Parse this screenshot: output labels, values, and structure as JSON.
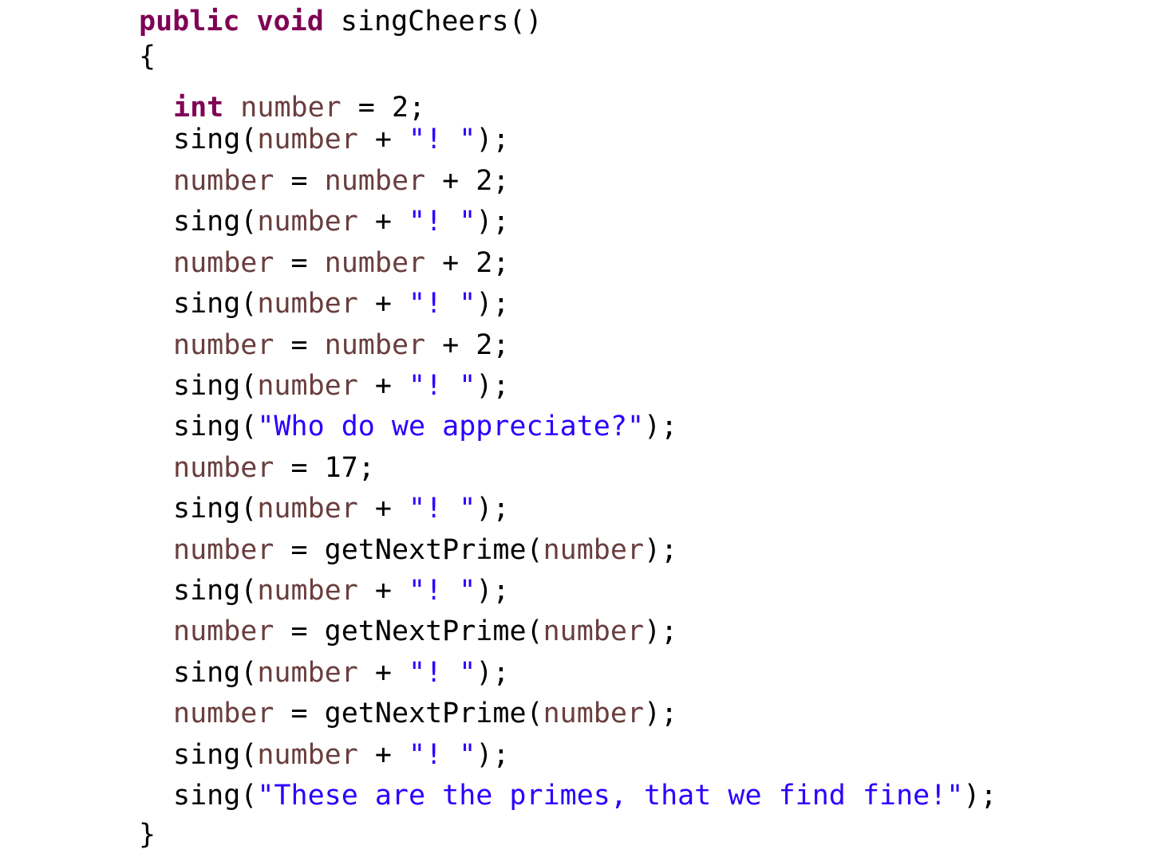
{
  "editor": {
    "colors": {
      "keyword": "#7f0055",
      "local_variable": "#6a3e3e",
      "string": "#2a00ff",
      "plain": "#000000",
      "background": "#ffffff"
    },
    "lines": [
      [
        {
          "t": "public",
          "k": "keyword"
        },
        {
          "t": " ",
          "k": "plain"
        },
        {
          "t": "void",
          "k": "keyword"
        },
        {
          "t": " singCheers()",
          "k": "plain"
        }
      ],
      [
        {
          "t": "{",
          "k": "plain"
        }
      ],
      [
        {
          "t": "int",
          "k": "keyword"
        },
        {
          "t": " ",
          "k": "plain"
        },
        {
          "t": "number",
          "k": "local_variable"
        },
        {
          "t": " = 2;",
          "k": "plain"
        }
      ],
      [
        {
          "t": "sing(",
          "k": "plain"
        },
        {
          "t": "number",
          "k": "local_variable"
        },
        {
          "t": " + ",
          "k": "plain"
        },
        {
          "t": "\"! \"",
          "k": "string"
        },
        {
          "t": ");",
          "k": "plain"
        }
      ],
      [
        {
          "t": "number",
          "k": "local_variable"
        },
        {
          "t": " = ",
          "k": "plain"
        },
        {
          "t": "number",
          "k": "local_variable"
        },
        {
          "t": " + 2;",
          "k": "plain"
        }
      ],
      [
        {
          "t": "sing(",
          "k": "plain"
        },
        {
          "t": "number",
          "k": "local_variable"
        },
        {
          "t": " + ",
          "k": "plain"
        },
        {
          "t": "\"! \"",
          "k": "string"
        },
        {
          "t": ");",
          "k": "plain"
        }
      ],
      [
        {
          "t": "number",
          "k": "local_variable"
        },
        {
          "t": " = ",
          "k": "plain"
        },
        {
          "t": "number",
          "k": "local_variable"
        },
        {
          "t": " + 2;",
          "k": "plain"
        }
      ],
      [
        {
          "t": "sing(",
          "k": "plain"
        },
        {
          "t": "number",
          "k": "local_variable"
        },
        {
          "t": " + ",
          "k": "plain"
        },
        {
          "t": "\"! \"",
          "k": "string"
        },
        {
          "t": ");",
          "k": "plain"
        }
      ],
      [
        {
          "t": "number",
          "k": "local_variable"
        },
        {
          "t": " = ",
          "k": "plain"
        },
        {
          "t": "number",
          "k": "local_variable"
        },
        {
          "t": " + 2;",
          "k": "plain"
        }
      ],
      [
        {
          "t": "sing(",
          "k": "plain"
        },
        {
          "t": "number",
          "k": "local_variable"
        },
        {
          "t": " + ",
          "k": "plain"
        },
        {
          "t": "\"! \"",
          "k": "string"
        },
        {
          "t": ");",
          "k": "plain"
        }
      ],
      [
        {
          "t": "sing(",
          "k": "plain"
        },
        {
          "t": "\"Who do we appreciate?\"",
          "k": "string"
        },
        {
          "t": ");",
          "k": "plain"
        }
      ],
      [
        {
          "t": "number",
          "k": "local_variable"
        },
        {
          "t": " = 17;",
          "k": "plain"
        }
      ],
      [
        {
          "t": "sing(",
          "k": "plain"
        },
        {
          "t": "number",
          "k": "local_variable"
        },
        {
          "t": " + ",
          "k": "plain"
        },
        {
          "t": "\"! \"",
          "k": "string"
        },
        {
          "t": ");",
          "k": "plain"
        }
      ],
      [
        {
          "t": "number",
          "k": "local_variable"
        },
        {
          "t": " = getNextPrime(",
          "k": "plain"
        },
        {
          "t": "number",
          "k": "local_variable"
        },
        {
          "t": ");",
          "k": "plain"
        }
      ],
      [
        {
          "t": "sing(",
          "k": "plain"
        },
        {
          "t": "number",
          "k": "local_variable"
        },
        {
          "t": " + ",
          "k": "plain"
        },
        {
          "t": "\"! \"",
          "k": "string"
        },
        {
          "t": ");",
          "k": "plain"
        }
      ],
      [
        {
          "t": "number",
          "k": "local_variable"
        },
        {
          "t": " = getNextPrime(",
          "k": "plain"
        },
        {
          "t": "number",
          "k": "local_variable"
        },
        {
          "t": ");",
          "k": "plain"
        }
      ],
      [
        {
          "t": "sing(",
          "k": "plain"
        },
        {
          "t": "number",
          "k": "local_variable"
        },
        {
          "t": " + ",
          "k": "plain"
        },
        {
          "t": "\"! \"",
          "k": "string"
        },
        {
          "t": ");",
          "k": "plain"
        }
      ],
      [
        {
          "t": "number",
          "k": "local_variable"
        },
        {
          "t": " = getNextPrime(",
          "k": "plain"
        },
        {
          "t": "number",
          "k": "local_variable"
        },
        {
          "t": ");",
          "k": "plain"
        }
      ],
      [
        {
          "t": "sing(",
          "k": "plain"
        },
        {
          "t": "number",
          "k": "local_variable"
        },
        {
          "t": " + ",
          "k": "plain"
        },
        {
          "t": "\"! \"",
          "k": "string"
        },
        {
          "t": ");",
          "k": "plain"
        }
      ],
      [
        {
          "t": "sing(",
          "k": "plain"
        },
        {
          "t": "\"These are the primes, that we find fine!\"",
          "k": "string"
        },
        {
          "t": ");",
          "k": "plain"
        }
      ],
      [
        {
          "t": "}",
          "k": "plain"
        }
      ]
    ]
  }
}
